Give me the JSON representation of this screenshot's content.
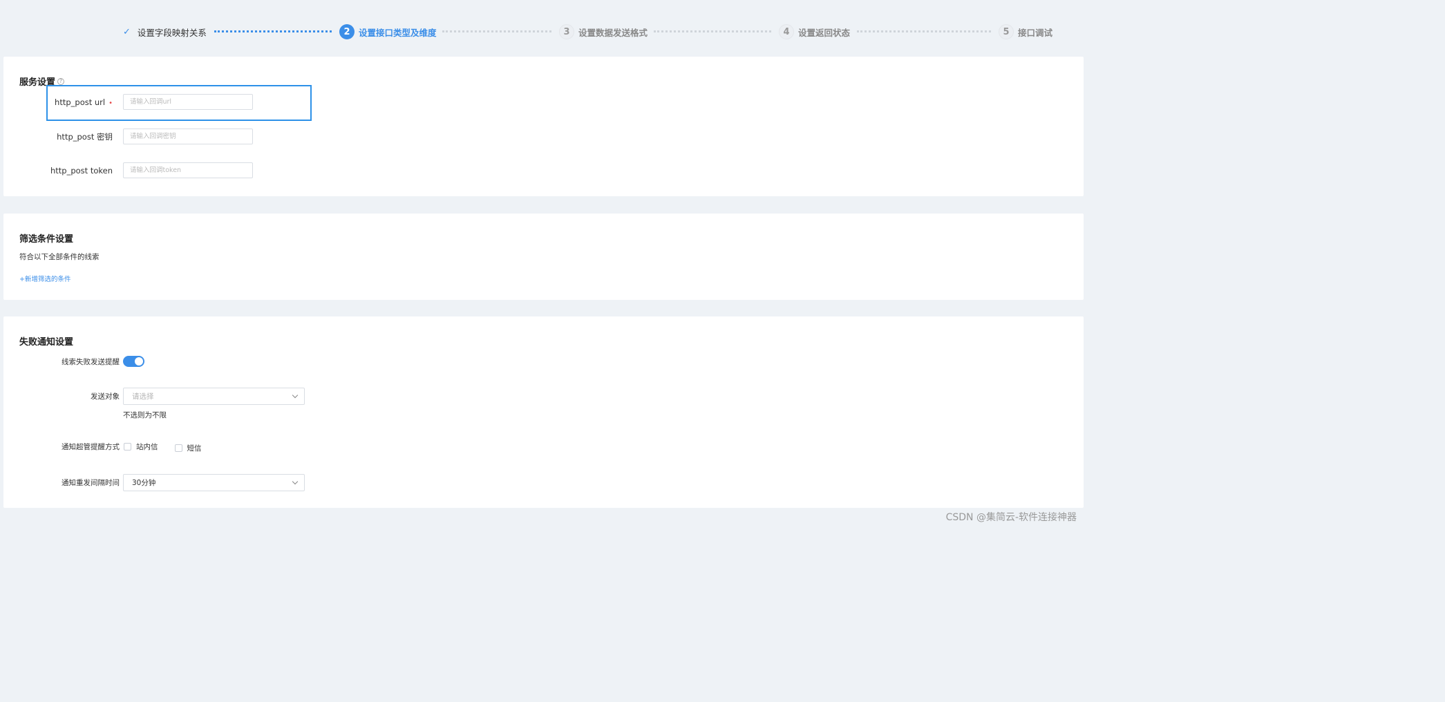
{
  "steps": [
    {
      "number": "",
      "label": "设置字段映射关系",
      "state": "done"
    },
    {
      "number": "2",
      "label": "设置接口类型及维度",
      "state": "active"
    },
    {
      "number": "3",
      "label": "设置数据发送格式",
      "state": "todo"
    },
    {
      "number": "4",
      "label": "设置返回状态",
      "state": "todo"
    },
    {
      "number": "5",
      "label": "接口调试",
      "state": "todo"
    }
  ],
  "service": {
    "title": "服务设置",
    "help_icon": "?",
    "url_label": "http_post url",
    "required_mark": "•",
    "url_placeholder": "请输入回调url",
    "secret_label": "http_post 密钥",
    "secret_placeholder": "请输入回调密钥",
    "token_label": "http_post token",
    "token_placeholder": "请输入回调token"
  },
  "filter": {
    "title": "筛选条件设置",
    "description": "符合以下全部条件的线索",
    "add_link": "+新增筛选的条件"
  },
  "failure": {
    "title": "失败通知设置",
    "toggle_label": "线索失败发送提醒",
    "toggle_on": true,
    "target_label": "发送对象",
    "target_placeholder": "请选择",
    "target_hint": "不选则为不限",
    "method_label": "通知超管提醒方式",
    "method_options": [
      "站内信",
      "短信"
    ],
    "interval_label": "通知重发间隔时间",
    "interval_value": "30分钟"
  },
  "watermark": "CSDN @集简云-软件连接神器",
  "colors": {
    "accent": "#3b8ee8",
    "required": "#e64a4a",
    "focus": "#2d91e8"
  }
}
